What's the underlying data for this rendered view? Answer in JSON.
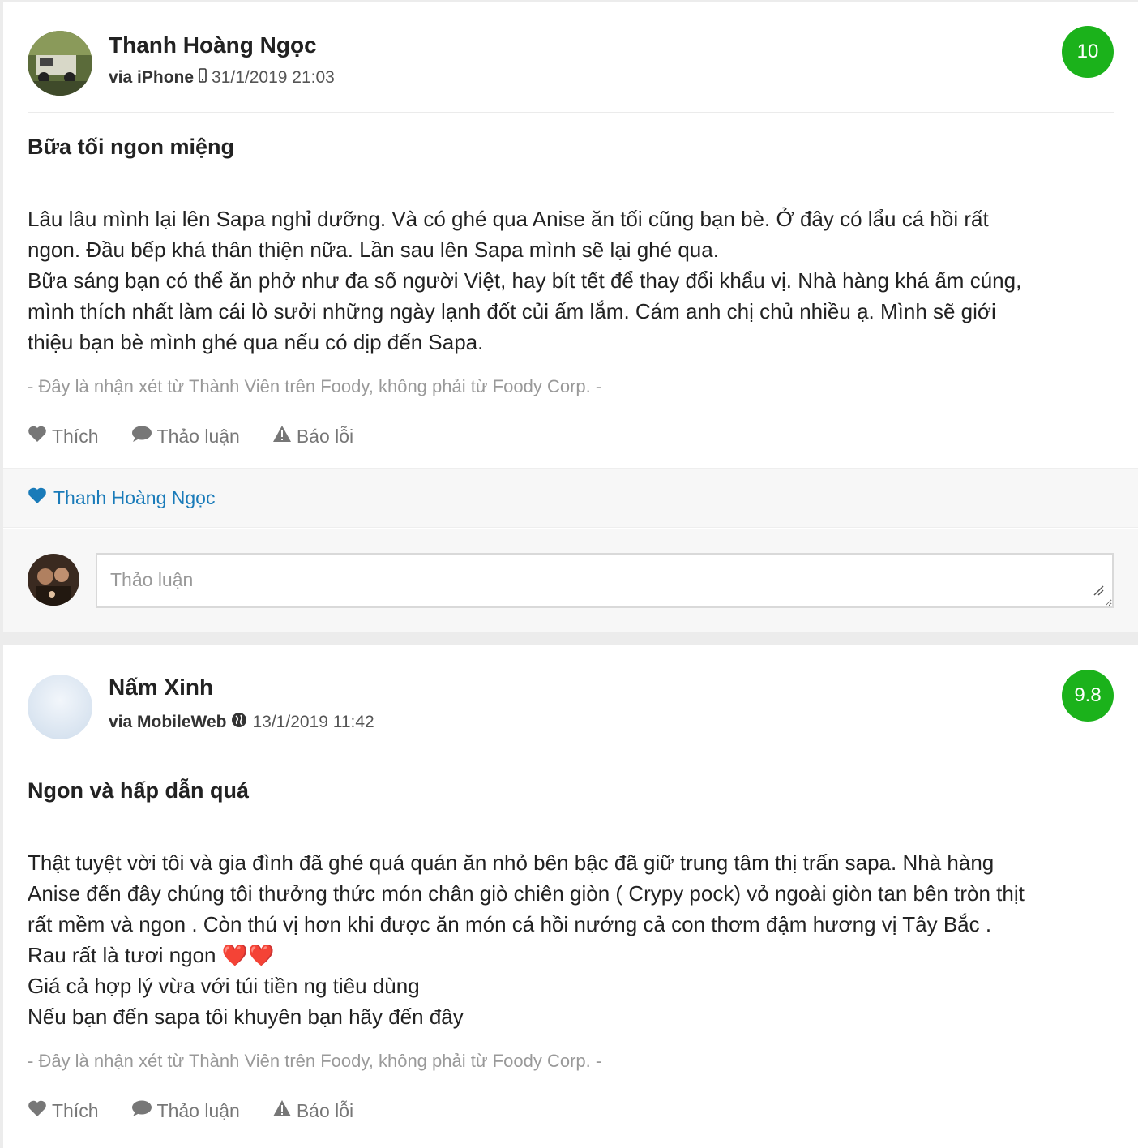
{
  "reviews": [
    {
      "user_name": "Thanh Hoàng Ngọc",
      "via": "via iPhone",
      "device_icon": "mobile-phone-icon",
      "timestamp": "31/1/2019 21:03",
      "score": "10",
      "title": "Bữa tối ngon miệng",
      "body_lines": [
        "Lâu lâu mình lại lên Sapa nghỉ dưỡng. Và có ghé qua Anise ăn tối cũng bạn bè. Ở đây có lẩu cá hồi rất",
        "ngon. Đầu bếp khá thân thiện nữa. Lần sau lên Sapa mình sẽ lại ghé qua.",
        "Bữa sáng bạn có thể ăn phở như đa số người Việt, hay bít tết để thay đổi khẩu vị. Nhà hàng khá ấm cúng,",
        "mình thích nhất làm cái lò sưởi những ngày lạnh đốt củi ấm lắm. Cám anh chị chủ nhiều ạ. Mình sẽ giới",
        "thiệu bạn bè mình ghé qua nếu có dịp đến Sapa."
      ],
      "disclaimer": "- Đây là nhận xét từ Thành Viên trên Foody, không phải từ Foody Corp. -",
      "actions": {
        "like": "Thích",
        "discuss": "Thảo luận",
        "report": "Báo lỗi"
      },
      "liked_by": "Thanh Hoàng Ngọc",
      "comment_placeholder": "Thảo luận"
    },
    {
      "user_name": "Nấm Xinh",
      "via": "via MobileWeb",
      "device_icon": "globe-icon",
      "timestamp": "13/1/2019 11:42",
      "score": "9.8",
      "title": "Ngon và hấp dẫn quá",
      "body_lines": [
        "Thật tuyệt vời tôi và gia đình đã ghé quá quán ăn nhỏ bên bậc đã giữ trung tâm thị trấn sapa. Nhà hàng",
        "Anise đến đây chúng tôi thưởng thức món chân giò chiên giòn ( Crypy pock) vỏ ngoài giòn tan bên tròn thịt",
        "rất mềm và ngon . Còn thú vị hơn khi được ăn món cá hồi nướng cả con thơm đậm hương vị Tây Bắc .",
        "Rau rất là tươi ngon ❤️❤️",
        "Giá cả hợp lý vừa với túi tiền ng tiêu dùng",
        "Nếu bạn đến sapa tôi khuyên bạn hãy đến đây"
      ],
      "disclaimer": "- Đây là nhận xét từ Thành Viên trên Foody, không phải từ Foody Corp. -",
      "actions": {
        "like": "Thích",
        "discuss": "Thảo luận",
        "report": "Báo lỗi"
      }
    }
  ],
  "colors": {
    "score_badge": "#1bb21b",
    "liker_link": "#1a7bb9",
    "action_text": "#777777",
    "disclaimer_text": "#999999"
  }
}
